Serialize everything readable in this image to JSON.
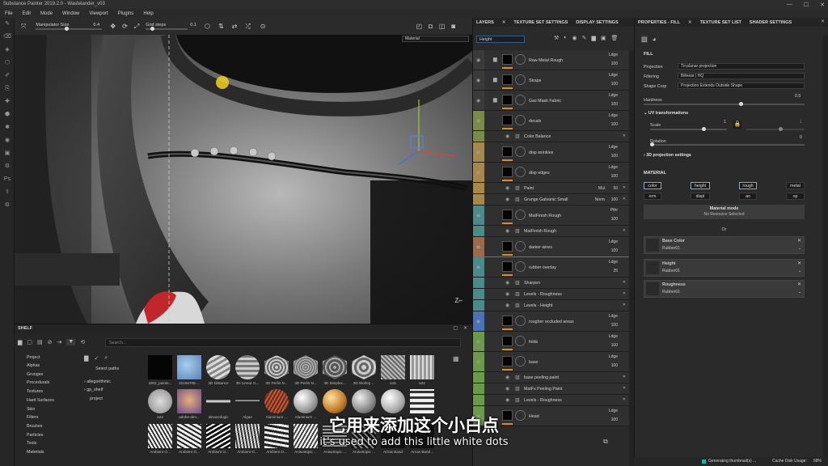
{
  "window": {
    "title": "Substance Painter 2019.2.0 - Wastelander_v03",
    "controls": [
      "—",
      "☐",
      "✕"
    ]
  },
  "menu": [
    "File",
    "Edit",
    "Mode",
    "Window",
    "Viewport",
    "Plugins",
    "Help"
  ],
  "toolbar": {
    "manipulator_label": "Manipulator Size",
    "manipulator_value": "0.4",
    "grid_label": "Grid steps",
    "grid_value": "0.1",
    "viewport_mode": "Material"
  },
  "layers_panel": {
    "tabs": [
      "LAYERS",
      "TEXTURE SET SETTINGS",
      "DISPLAY SETTINGS"
    ],
    "channel_filter": "Height",
    "layers": [
      {
        "name": "Raw Metal Rough",
        "blend": "Ldge",
        "opacity": "100",
        "color": "#3a3a3a",
        "kind": "folder"
      },
      {
        "name": "Straps",
        "blend": "Ldge",
        "opacity": "100",
        "color": "#3a3a3a",
        "kind": "folder"
      },
      {
        "name": "Gas Mask Fabric",
        "blend": "Ldge",
        "opacity": "100",
        "color": "#3a3a3a",
        "kind": "folder"
      },
      {
        "name": "decals",
        "blend": "Ldge",
        "opacity": "100",
        "color": "#7a8a4a",
        "kind": "layer"
      },
      {
        "name": "Color Balance",
        "color": "#7a8a4a",
        "kind": "effect"
      },
      {
        "name": "disp wrinkles",
        "blend": "Ldge",
        "opacity": "100",
        "color": "#a8884a",
        "kind": "layer"
      },
      {
        "name": "disp edges",
        "blend": "Ldge",
        "opacity": "100",
        "color": "#a8884a",
        "kind": "layer"
      },
      {
        "name": "Paint",
        "blend": "Mul",
        "opacity": "50",
        "color": "#a8884a",
        "kind": "effect"
      },
      {
        "name": "Grunge Galvanic Small",
        "blend": "Norm",
        "opacity": "100",
        "color": "#a8884a",
        "kind": "effect"
      },
      {
        "name": "MatFinish Rough",
        "blend": "Pthr",
        "opacity": "100",
        "color": "#4a8a8a",
        "kind": "layer"
      },
      {
        "name": "MatFinish Rough",
        "color": "#4a8a8a",
        "kind": "effect"
      },
      {
        "name": "darker wires",
        "blend": "Ldge",
        "opacity": "100",
        "color": "#9a6a4a",
        "kind": "layer"
      },
      {
        "name": "rubber overlay",
        "blend": "Ldge",
        "opacity": "25",
        "color": "#4a8a8a",
        "kind": "layer"
      },
      {
        "name": "Sharpen",
        "color": "#4a8a8a",
        "kind": "effect"
      },
      {
        "name": "Levels - Roughness",
        "color": "#4a8a8a",
        "kind": "effect"
      },
      {
        "name": "Levels - Height",
        "color": "#4a8a8a",
        "kind": "effect"
      },
      {
        "name": "rougher occluded areas",
        "blend": "Ldge",
        "opacity": "100",
        "color": "#4a72b8",
        "kind": "layer"
      },
      {
        "name": "folds",
        "blend": "Ldge",
        "opacity": "100",
        "color": "#6a9a4a",
        "kind": "layer"
      },
      {
        "name": "base",
        "blend": "Ldge",
        "opacity": "100",
        "color": "#6a9a4a",
        "kind": "layer"
      },
      {
        "name": "base peeling paint",
        "color": "#6a9a4a",
        "kind": "effect"
      },
      {
        "name": "MatFx Peeling Paint",
        "color": "#6a9a4a",
        "kind": "effect"
      },
      {
        "name": "Levels - Roughness",
        "color": "#6a9a4a",
        "kind": "effect"
      },
      {
        "name": "Head",
        "blend": "Ldge",
        "opacity": "100",
        "color": "#6a9a4a",
        "kind": "layer"
      }
    ]
  },
  "props_panel": {
    "tabs": [
      "PROPERTIES - FILL",
      "TEXTURE SET LIST",
      "SHADER SETTINGS"
    ],
    "section": "FILL",
    "projection_label": "Projection",
    "projection_value": "Tri-planar projection",
    "filtering_label": "Filtering",
    "filtering_value": "Bilinear | HQ",
    "shapecrop_label": "Shape Crop",
    "shapecrop_value": "Projection Extends Outside Shape",
    "hardness_label": "Hardness",
    "hardness_value": "0.5",
    "uv_title": "UV transformations",
    "scale_label": "Scale",
    "scale_value": "1",
    "scale_value2": "1",
    "rotation_label": "Rotation",
    "rotation_value": "0",
    "proj3d_title": "3D projection settings",
    "material_title": "MATERIAL",
    "channels_row1": [
      "color",
      "height",
      "rough",
      "metal"
    ],
    "channels_row2": [
      "nrm",
      "displ",
      "ao",
      "op"
    ],
    "material_mode_label": "Material mode",
    "material_mode_value": "No Resource Selected",
    "or_label": "Or",
    "slots": [
      {
        "name": "Base Color",
        "resource": "Rubber01"
      },
      {
        "name": "Height",
        "resource": "Rubber01"
      },
      {
        "name": "Roughness",
        "resource": "Rubber01"
      }
    ]
  },
  "shelf": {
    "title": "SHELF",
    "search_placeholder": "Search...",
    "categories": [
      "Project",
      "Alphas",
      "Grunges",
      "Procedurals",
      "Textures",
      "Hard Surfaces",
      "Skin",
      "Filters",
      "Brushes",
      "Particles",
      "Tools",
      "Materials"
    ],
    "paths_label": "Select paths",
    "tree": [
      "allegorithmic",
      "gp_shelf",
      "project"
    ],
    "items_row1": [
      "1802_painte...",
      "10155785-...",
      "3D Distance",
      "3D Linear G...",
      "3D Perlin N...",
      "3D Perlin N...",
      "3D Simplex...",
      "3D Worley ...",
      "a15",
      "a22"
    ],
    "items_row2": [
      "a24",
      "adobe-dim...",
      "alexarrdogic",
      "Algae",
      "Aluminium ...",
      "Aluminium ...",
      "",
      "",
      "",
      ""
    ],
    "items_row3": [
      "Ambient O...",
      "Ambient O...",
      "Ambient O...",
      "Ambient O...",
      "Ambient O...",
      "Anisotropic ...",
      "Anisotropic ...",
      "Anisotropic ...",
      "Arrow Band",
      "Arrow Band..."
    ]
  },
  "subtitles": {
    "cn": "它用来添加这个小白点",
    "en": "it's used to add this little white dots"
  },
  "status": {
    "left": "Generating thumbnail(s) ...",
    "right": "Cache Disk Usage:",
    "percent": "68%"
  }
}
